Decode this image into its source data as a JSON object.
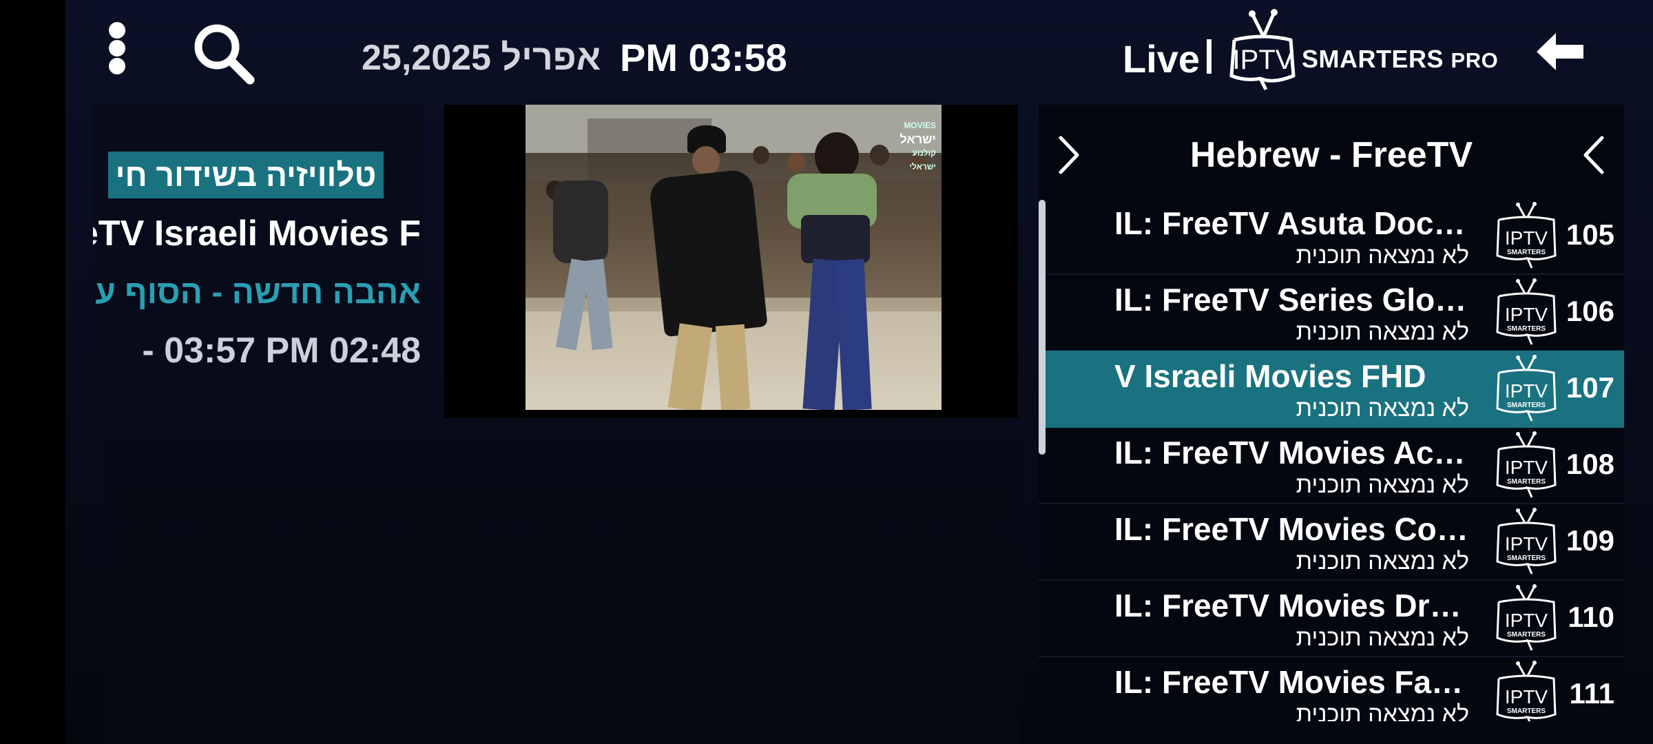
{
  "header": {
    "date": "אפריל 25,2025",
    "time": "PM 03:58",
    "live_label": "Live",
    "brand_iptv": "IPTV",
    "brand_smarters": "SMARTERS",
    "brand_pro": "PRO"
  },
  "info": {
    "badge": "טלוויזיה בשידור חי",
    "channel": "eTV Israeli Movies F",
    "program": "אהבה חדשה - הסוף ע",
    "time_range": "- 03:57 PM 02:48"
  },
  "video": {
    "watermark_brand": "MOVIES",
    "watermark_name": "ישראל",
    "watermark_sub": "קולנוע ישראלי"
  },
  "channels": {
    "category": "Hebrew - FreeTV",
    "items": [
      {
        "number": "105",
        "name": "IL: FreeTV Asuta Documentary",
        "epg": "לא נמצאה תוכנית",
        "logo_text": "IPTV",
        "logo_sub": "SMARTERS"
      },
      {
        "number": "106",
        "name": "IL: FreeTV Series Global",
        "epg": "לא נמצאה תוכנית",
        "logo_text": "IPTV",
        "logo_sub": "SMARTERS"
      },
      {
        "number": "107",
        "name": "V Israeli Movies FHD",
        "epg": "לא נמצאה תוכנית",
        "logo_text": "IPTV",
        "logo_sub": "SMARTERS"
      },
      {
        "number": "108",
        "name": "IL: FreeTV Movies Action",
        "epg": "לא נמצאה תוכנית",
        "logo_text": "IPTV",
        "logo_sub": "SMARTERS"
      },
      {
        "number": "109",
        "name": "IL: FreeTV Movies Comedy",
        "epg": "לא נמצאה תוכנית",
        "logo_text": "IPTV",
        "logo_sub": "SMARTERS"
      },
      {
        "number": "110",
        "name": "IL: FreeTV Movies Drama",
        "epg": "לא נמצאה תוכנית",
        "logo_text": "IPTV",
        "logo_sub": "SMARTERS"
      },
      {
        "number": "111",
        "name": "IL: FreeTV Movies Family",
        "epg": "לא נמצאה תוכנית",
        "logo_text": "IPTV",
        "logo_sub": "SMARTERS"
      }
    ]
  },
  "colors": {
    "accent": "#1a7280",
    "program_text": "#2a9fb3",
    "background": "#0b1026"
  },
  "icons": [
    "more-vertical-icon",
    "search-icon",
    "tv-antenna-icon",
    "back-arrow-icon",
    "chevron-right-icon",
    "chevron-left-icon"
  ]
}
